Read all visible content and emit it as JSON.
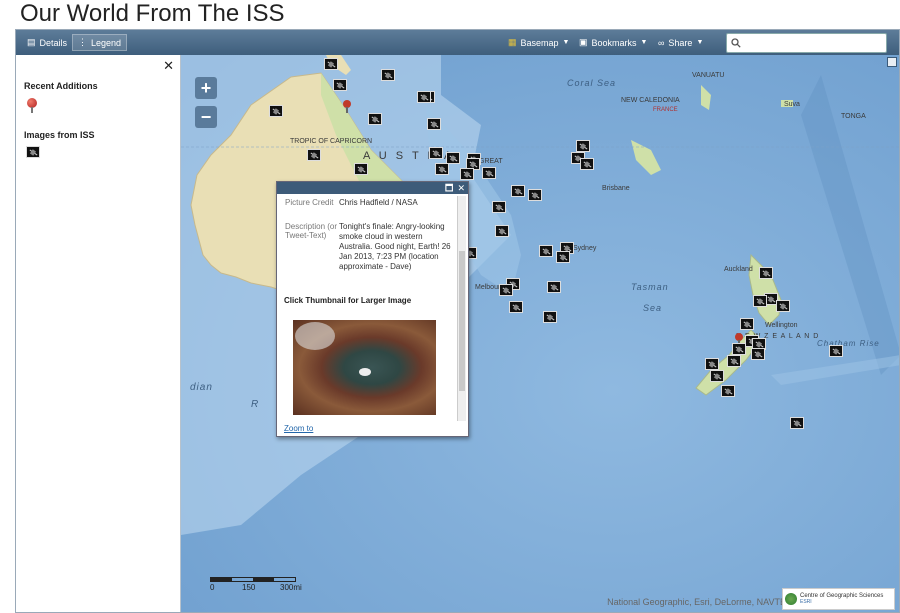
{
  "page": {
    "title": "Our World From The ISS"
  },
  "toolbar": {
    "details": "Details",
    "legend": "Legend",
    "basemap": "Basemap",
    "bookmarks": "Bookmarks",
    "share": "Share",
    "search_placeholder": ""
  },
  "panel": {
    "close": "✕",
    "recent_additions": "Recent Additions",
    "images_from_iss": "Images from ISS"
  },
  "map": {
    "zoom_in": "+",
    "zoom_out": "−",
    "labels": {
      "coral_sea": "Coral Sea",
      "vanuatu": "VANUATU",
      "new_caledonia": "NEW CALEDONIA",
      "france": "FRANCE",
      "suva": "Suva",
      "tonga": "TONGA",
      "tropic": "TROPIC OF CAPRICORN",
      "austra": "A U S T R A",
      "brisbane": "Brisbane",
      "sydney": "Sydney",
      "melbourne": "Melbourne",
      "tasman": "Tasman",
      "sea": "Sea",
      "auckland": "Auckland",
      "wellington": "Wellington",
      "nz": "N E W   Z E A L A N D",
      "chatham": "Chatham Rise",
      "great": "GREAT",
      "indian": "dian",
      "r": "R"
    },
    "attribution": "National Geographic, Esri, DeLorme, NAVTEQ, UNEP-WCMC, USGS...",
    "cgs": "Centre of Geographic Sciences",
    "cgs_sub": "ESRI",
    "scale": {
      "t0": "0",
      "t1": "150",
      "t2": "300mi"
    }
  },
  "popup": {
    "credit_label": "Picture Credit",
    "credit_value": "Chris Hadfield / NASA",
    "desc_label": "Description (or Tweet-Text)",
    "desc_value": "Tonight's finale: Angry-looking smoke cloud in western Australia. Good night, Earth! 26 Jan 2013, 7:23 PM (location approximate - Dave)",
    "click_thumb": "Click Thumbnail for Larger Image",
    "zoom_to": "Zoom to",
    "maximize": "🗖",
    "close": "✕"
  }
}
